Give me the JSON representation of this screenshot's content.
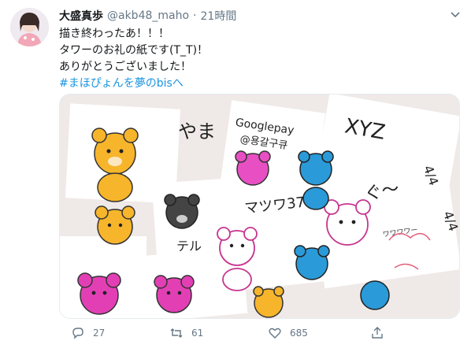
{
  "tweet": {
    "display_name": "大盛真歩",
    "handle": "@akb48_maho",
    "separator": "·",
    "time": "21時間",
    "lines": [
      "描き終わったあ！！！",
      "タワーのお礼の紙です(T_T)！",
      "ありがとうございました！"
    ],
    "hashtag": "#まほぴょんを夢のbisへ",
    "media": {
      "cards": [
        "やま",
        "Googlepay",
        "@용갈구큐",
        "XYZ",
        "4/4",
        "ぐ〜",
        "4/4",
        "マツワ37",
        "テル",
        "ワワワワー"
      ]
    },
    "actions": {
      "reply_count": "27",
      "retweet_count": "61",
      "like_count": "685"
    }
  },
  "colors": {
    "link": "#1b95e0",
    "muted": "#657786",
    "text": "#14171a"
  }
}
